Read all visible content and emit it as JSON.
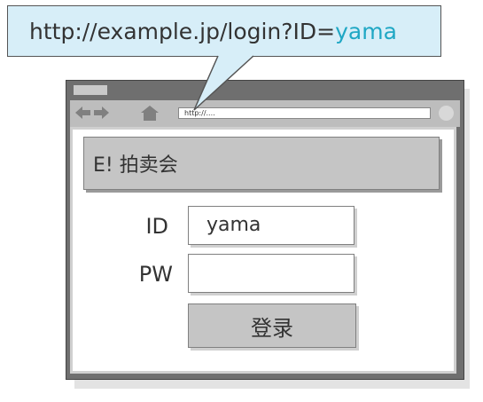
{
  "callout": {
    "url_prefix": "http://example.jp/login?ID=",
    "url_value": "yama"
  },
  "browser": {
    "address_text": "http://...."
  },
  "page": {
    "site_title": "E! 拍卖会",
    "id_label": "ID",
    "id_value": "yama",
    "pw_label": "PW",
    "pw_value": "",
    "login_button": "登录"
  },
  "colors": {
    "callout_bg": "#d7eef8",
    "highlight": "#1fa7c4",
    "frame": "#6f6f6f",
    "panel_gray": "#c5c5c5"
  },
  "icons": [
    "back-arrow-icon",
    "forward-arrow-icon",
    "home-icon",
    "reload-icon"
  ]
}
